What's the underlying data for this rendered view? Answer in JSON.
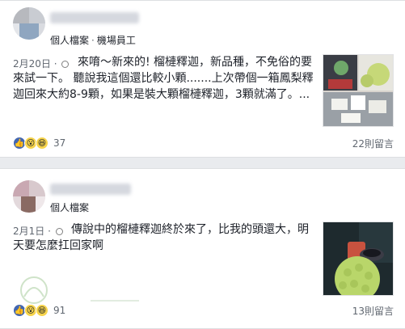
{
  "posts": [
    {
      "profile_type": "個人檔案",
      "separator": "·",
      "role": "機場員工",
      "date": "2月20日",
      "date_dot": "·",
      "text": "來唷～新來的! 榴槤釋迦，新品種，不免俗的要來試一下。 聽說我這個還比較小顆.......上次帶個一箱鳳梨釋迦回來大約8-9顆，如果是裝大顆榴槤釋迦，3顆就滿了。...",
      "reaction_count": "37",
      "comments": "22則留言"
    },
    {
      "profile_type": "個人檔案",
      "date": "2月1日",
      "date_dot": "·",
      "text": "傳說中的榴槤釋迦終於來了，比我的頭還大，明天要怎麼扛回家啊",
      "reaction_count": "91",
      "comments": "13則留言"
    }
  ],
  "icons": {
    "globe": "globe-icon",
    "like": "like-reaction-icon",
    "wow": "wow-reaction-icon",
    "haha": "haha-reaction-icon"
  },
  "colors": {
    "facebook_blue": "#4267b2",
    "durian_green": "#b9d66a"
  }
}
